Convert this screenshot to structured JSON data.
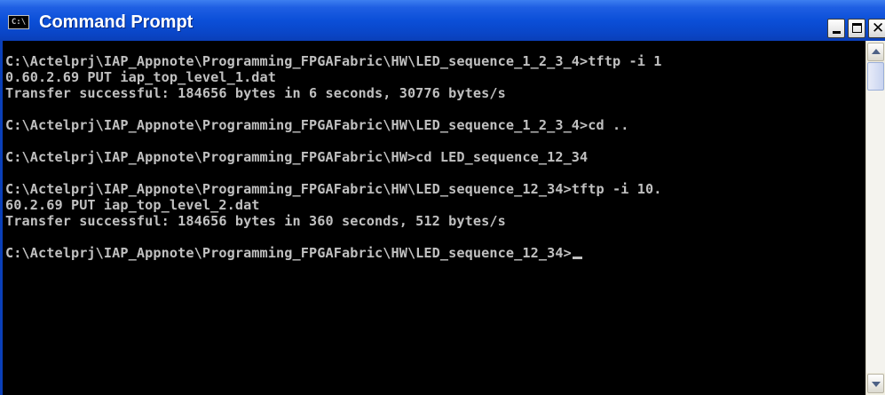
{
  "window": {
    "title": "Command Prompt",
    "icon": "cmd-icon",
    "icon_glyph": "C:\\",
    "controls": {
      "minimize": "minimize-icon",
      "maximize": "maximize-icon",
      "close": "close-icon",
      "close_glyph": "✕"
    }
  },
  "console": {
    "background": "#000000",
    "foreground": "#c0c0c0",
    "lines": [
      "C:\\Actelprj\\IAP_Appnote\\Programming_FPGAFabric\\HW\\LED_sequence_1_2_3_4>tftp -i 1",
      "0.60.2.69 PUT iap_top_level_1.dat",
      "Transfer successful: 184656 bytes in 6 seconds, 30776 bytes/s",
      "",
      "C:\\Actelprj\\IAP_Appnote\\Programming_FPGAFabric\\HW\\LED_sequence_1_2_3_4>cd ..",
      "",
      "C:\\Actelprj\\IAP_Appnote\\Programming_FPGAFabric\\HW>cd LED_sequence_12_34",
      "",
      "C:\\Actelprj\\IAP_Appnote\\Programming_FPGAFabric\\HW\\LED_sequence_12_34>tftp -i 10.",
      "60.2.69 PUT iap_top_level_2.dat",
      "Transfer successful: 184656 bytes in 360 seconds, 512 bytes/s",
      "",
      "C:\\Actelprj\\IAP_Appnote\\Programming_FPGAFabric\\HW\\LED_sequence_12_34>"
    ]
  },
  "colors": {
    "titlebar": "#0b4fd8",
    "title_text": "#ffffff",
    "scrollbar_track": "#f4f3ee"
  }
}
